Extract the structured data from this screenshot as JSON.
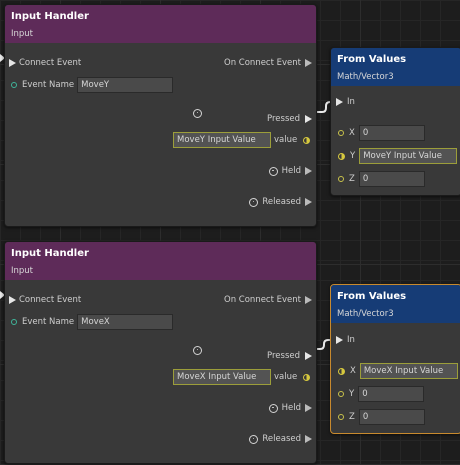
{
  "nodes": {
    "handler_top": {
      "title": "Input Handler",
      "subtitle": "Input",
      "connect_event": "Connect Event",
      "event_name_label": "Event Name",
      "event_name_value": "MoveY",
      "on_connect_event": "On Connect Event",
      "pressed": "Pressed",
      "value_label": "value",
      "value_field": "MoveY Input Value",
      "held": "Held",
      "released": "Released"
    },
    "from_values_top": {
      "title": "From Values",
      "subtitle": "Math/Vector3",
      "in_label": "In",
      "x_label": "X",
      "x_value": "0",
      "y_label": "Y",
      "y_value": "MoveY Input Value",
      "z_label": "Z",
      "z_value": "0"
    },
    "handler_bottom": {
      "title": "Input Handler",
      "subtitle": "Input",
      "connect_event": "Connect Event",
      "event_name_label": "Event Name",
      "event_name_value": "MoveX",
      "on_connect_event": "On Connect Event",
      "pressed": "Pressed",
      "value_label": "value",
      "value_field": "MoveX Input Value",
      "held": "Held",
      "released": "Released"
    },
    "from_values_bottom": {
      "title": "From Values",
      "subtitle": "Math/Vector3",
      "in_label": "In",
      "x_label": "X",
      "x_value": "MoveX Input Value",
      "y_label": "Y",
      "y_value": "0",
      "z_label": "Z",
      "z_value": "0"
    }
  },
  "colors": {
    "handler_header": "#5e2b59",
    "from_values_header": "#163c76",
    "node_body": "#393939",
    "selected_border": "#c88a2e",
    "float_port": "#d6c83e",
    "string_port": "#3fb59a"
  }
}
